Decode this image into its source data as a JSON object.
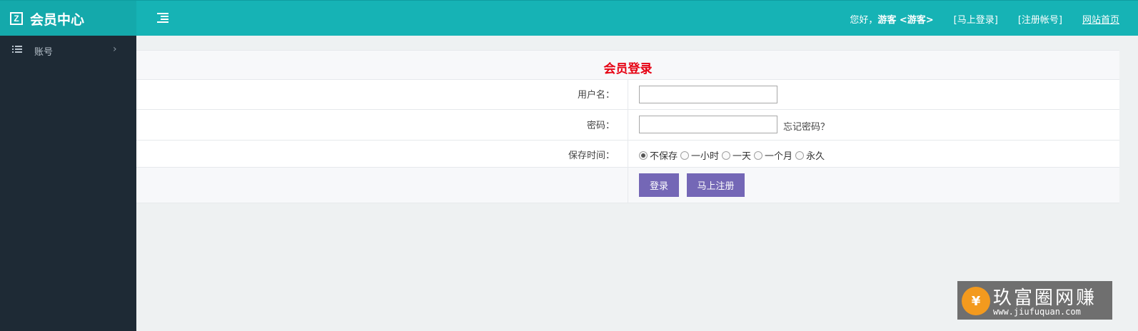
{
  "header": {
    "logo_letter": "Z",
    "title": "会员中心",
    "greeting_prefix": "您好，",
    "greeting_user": "游客 <游客>",
    "login_link": "[马上登录]",
    "register_link": "[注册帐号]",
    "home_link": "网站首页"
  },
  "sidebar": {
    "items": [
      {
        "label": "账号",
        "chevron": "›"
      }
    ]
  },
  "form": {
    "title": "会员登录",
    "username_label": "用户名：",
    "username_value": "",
    "password_label": "密码：",
    "password_value": "",
    "forgot_link": "忘记密码？",
    "save_time_label": "保存时间：",
    "save_options": [
      {
        "label": "不保存",
        "checked": true
      },
      {
        "label": "一小时",
        "checked": false
      },
      {
        "label": "一天",
        "checked": false
      },
      {
        "label": "一个月",
        "checked": false
      },
      {
        "label": "永久",
        "checked": false
      }
    ],
    "login_button": "登录",
    "register_button": "马上注册"
  },
  "watermark": {
    "badge": "¥",
    "text": "玖富圈网赚",
    "url": "www.jiufuquan.com"
  },
  "colors": {
    "topbar": "#16b3b5",
    "sidebar": "#1e2a35",
    "title_red": "#e60012",
    "button": "#7467b6"
  }
}
